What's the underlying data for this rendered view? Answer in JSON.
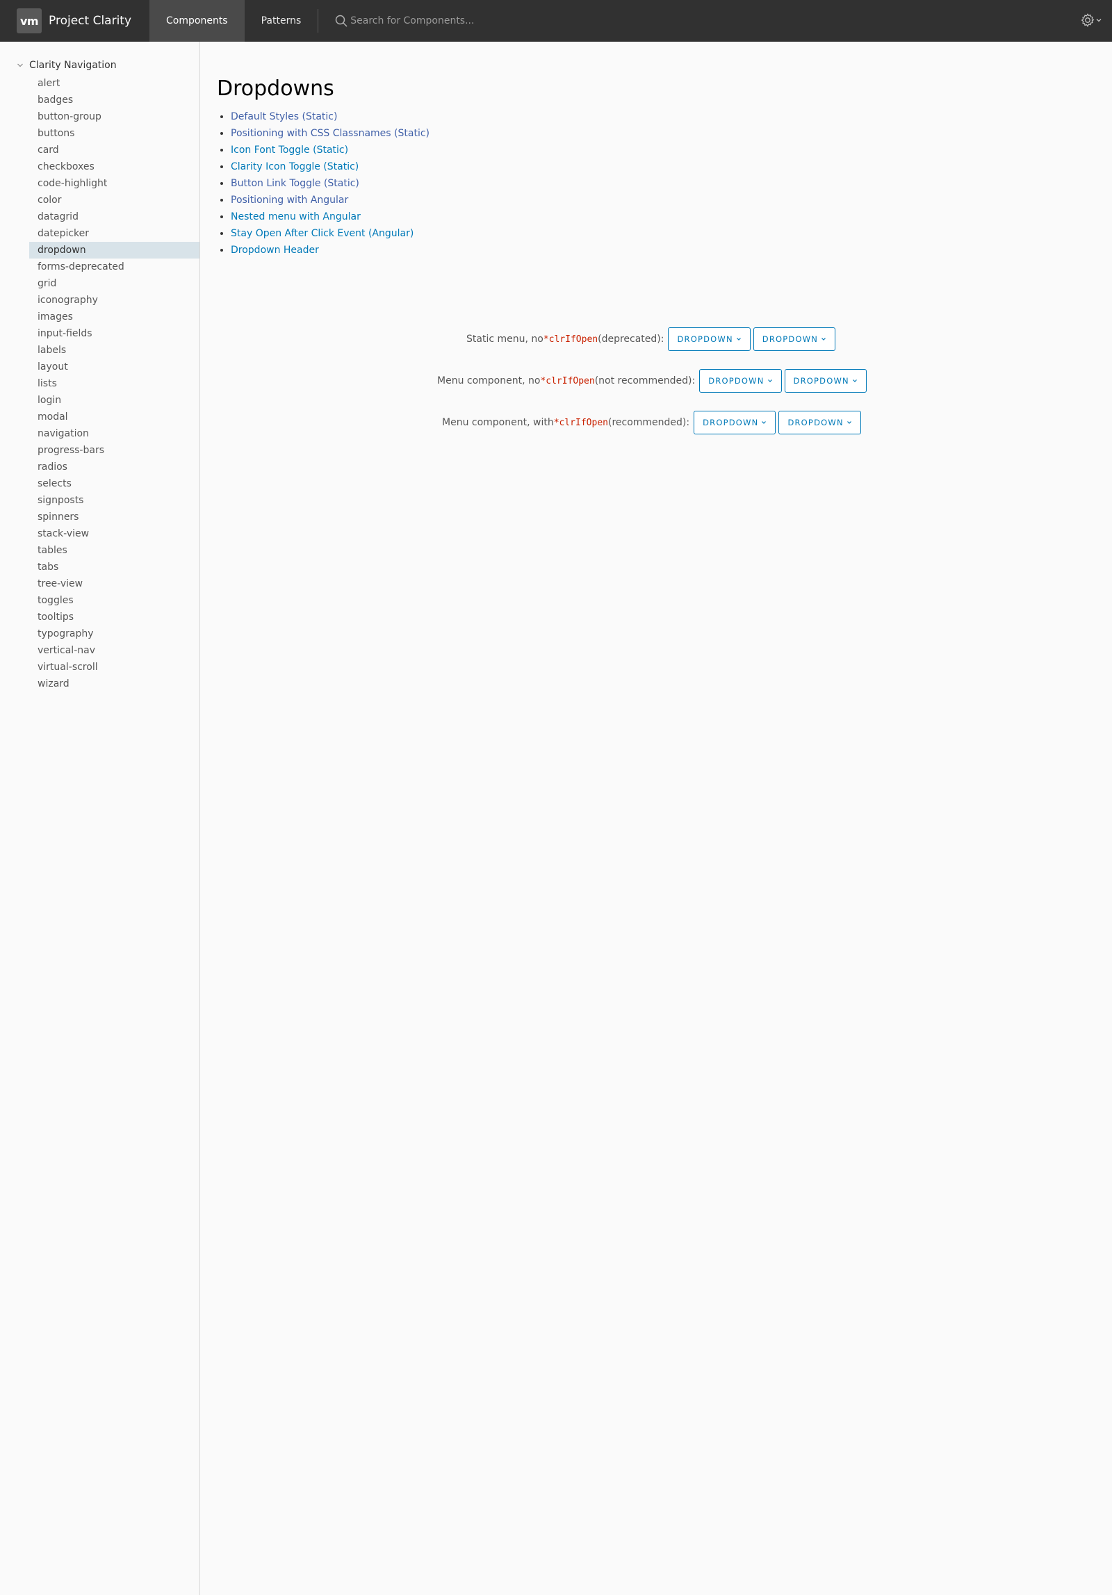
{
  "header": {
    "logo": "vm",
    "brand": "Project Clarity",
    "tabs": [
      {
        "label": "Components",
        "active": true
      },
      {
        "label": "Patterns",
        "active": false
      }
    ],
    "search_placeholder": "Search for Components...",
    "settings_icon": "gear-icon"
  },
  "sidebar": {
    "title": "Clarity Navigation",
    "items": [
      "alert",
      "badges",
      "button-group",
      "buttons",
      "card",
      "checkboxes",
      "code-highlight",
      "color",
      "datagrid",
      "datepicker",
      "dropdown",
      "forms-deprecated",
      "grid",
      "iconography",
      "images",
      "input-fields",
      "labels",
      "layout",
      "lists",
      "login",
      "modal",
      "navigation",
      "progress-bars",
      "radios",
      "selects",
      "signposts",
      "spinners",
      "stack-view",
      "tables",
      "tabs",
      "tree-view",
      "toggles",
      "tooltips",
      "typography",
      "vertical-nav",
      "virtual-scroll",
      "wizard"
    ],
    "active_item": "dropdown"
  },
  "main": {
    "title": "Dropdowns",
    "links": [
      "Default Styles (Static)",
      "Positioning with CSS Classnames (Static)",
      "Icon Font Toggle (Static)",
      "Clarity Icon Toggle (Static)",
      "Button Link Toggle (Static)",
      "Positioning with Angular",
      "Nested menu with Angular",
      "Stay Open After Click Event (Angular)",
      "Dropdown Header"
    ],
    "rows": [
      {
        "prefix": "Static menu, no ",
        "code": "*clrIfOpen",
        "suffix": " (deprecated):",
        "buttons": [
          "DROPDOWN",
          "DROPDOWN"
        ]
      },
      {
        "prefix": "Menu component, no ",
        "code": "*clrIfOpen",
        "suffix": " (not recommended):",
        "buttons": [
          "DROPDOWN",
          "DROPDOWN"
        ]
      },
      {
        "prefix": "Menu component, with ",
        "code": "*clrIfOpen",
        "suffix": " (recommended):",
        "buttons": [
          "DROPDOWN",
          "DROPDOWN"
        ]
      }
    ]
  },
  "colors": {
    "header_bg": "#313131",
    "active_tab_bg": "#4a4a4a",
    "link_blue": "#0079b8",
    "code_red": "#c92100",
    "selected_nav_bg": "#d8e3e9"
  }
}
